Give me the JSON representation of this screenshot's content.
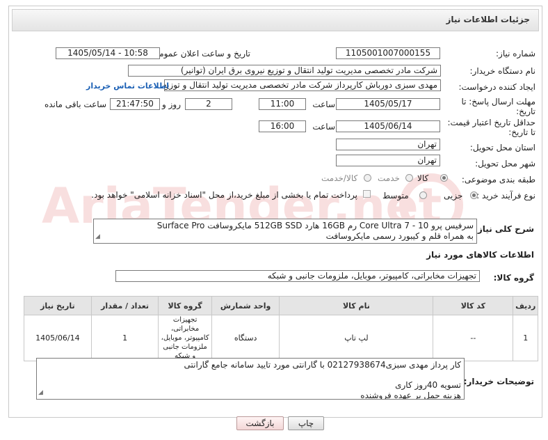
{
  "header": {
    "title": "جزئیات اطلاعات نیاز"
  },
  "fields": {
    "need_number_label": "شماره نیاز:",
    "need_number": "1105001007000155",
    "announce_label": "تاریخ و ساعت اعلان عمومی:",
    "announce_value": "1405/05/14 - 10:58",
    "buyer_label": "نام دستگاه خریدار:",
    "buyer_value": "شرکت مادر تخصصی مدیریت تولید  انتقال و توزیع نیروی برق ایران (توانیر)",
    "creator_label": "ایجاد کننده درخواست:",
    "creator_value": "مهدی سبزی دورباش کارپرداز شرکت مادر تخصصی مدیریت تولید  انتقال و توزیع ن",
    "contact_link": "اطلاعات تماس خریدار",
    "send_deadline_label_1": "مهلت ارسال پاسخ: تا",
    "send_deadline_label_2": "تاریخ:",
    "send_date": "1405/05/17",
    "time_label": "ساعت",
    "send_time": "11:00",
    "days_value": "2",
    "days_label": "روز و",
    "remaining_time": "21:47:50",
    "remaining_label": "ساعت باقی مانده",
    "validity_label_1": "حداقل تاریخ اعتبار قیمت:",
    "validity_label_2": "تا تاریخ:",
    "validity_date": "1405/06/14",
    "validity_time": "16:00",
    "province_label": "استان محل تحویل:",
    "province_value": "تهران",
    "city_label": "شهر محل تحویل:",
    "city_value": "تهران",
    "category_label": "طبقه بندی موضوعی:",
    "category_options": [
      "کالا",
      "خدمت",
      "کالا/خدمت"
    ],
    "process_label": "نوع فرآیند خرید :",
    "process_options": [
      "جزیی",
      "متوسط"
    ],
    "payment_note": "پرداخت تمام یا بخشی از مبلغ خرید،از محل \"اسناد خزانه اسلامی\" خواهد بود."
  },
  "description": {
    "label": "شرح کلی نیاز:",
    "line1": "سرفیس پرو 10 - Core Ultra 7 رم 16GB هارد 512GB SSD مایکروسافت Surface Pro",
    "line2": "به همراه قلم و کیبورد رسمی مایکروسافت"
  },
  "goods_section": {
    "title": "اطلاعات کالاهای مورد نیاز",
    "group_label": "گروه کالا:",
    "group_value": "تجهیزات مخابراتی، کامپیوتر، موبایل، ملزومات جانبی و شبکه"
  },
  "table": {
    "headers": [
      "ردیف",
      "کد کالا",
      "نام کالا",
      "واحد شمارش",
      "گروه کالا",
      "تعداد / مقدار",
      "تاریخ نیاز"
    ],
    "rows": [
      {
        "row": "1",
        "code": "--",
        "name": "لپ تاپ",
        "unit": "دستگاه",
        "group": "تجهیزات مخابراتی، کامپیوتر، موبایل، ملزومات جانبی و شبکه",
        "qty": "1",
        "date": "1405/06/14"
      }
    ]
  },
  "buyer_notes": {
    "label": "توضیحات خریدار:",
    "line1": "کار پرداز مهدی سبزی02127938674 با گارانتی مورد تایید سامانه جامع گارانتی",
    "line2": "تسویه 40روز کاری",
    "line3": "هزینه حمل بر  عهده فروشنده"
  },
  "buttons": {
    "print": "چاپ",
    "back": "بازگشت"
  },
  "watermark": {
    "text": "AriaTender.net"
  }
}
